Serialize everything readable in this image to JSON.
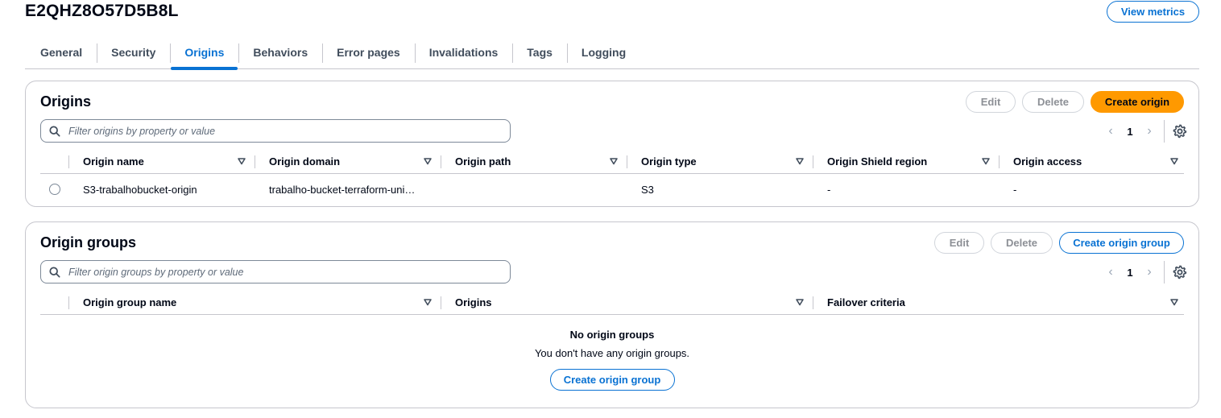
{
  "header": {
    "distribution_id": "E2QHZ8O57D5B8L",
    "view_metrics_label": "View metrics"
  },
  "tabs": [
    {
      "label": "General"
    },
    {
      "label": "Security"
    },
    {
      "label": "Origins",
      "active": true
    },
    {
      "label": "Behaviors"
    },
    {
      "label": "Error pages"
    },
    {
      "label": "Invalidations"
    },
    {
      "label": "Tags"
    },
    {
      "label": "Logging"
    }
  ],
  "origins": {
    "title": "Origins",
    "edit_label": "Edit",
    "delete_label": "Delete",
    "create_label": "Create origin",
    "filter_placeholder": "Filter origins by property or value",
    "page": "1",
    "columns": [
      "Origin name",
      "Origin domain",
      "Origin path",
      "Origin type",
      "Origin Shield region",
      "Origin access"
    ],
    "rows": [
      {
        "name": "S3-trabalhobucket-origin",
        "domain": "trabalho-bucket-terraform-uni…",
        "path": "",
        "type": "S3",
        "shield_region": "-",
        "access": "-"
      }
    ]
  },
  "origin_groups": {
    "title": "Origin groups",
    "edit_label": "Edit",
    "delete_label": "Delete",
    "create_label": "Create origin group",
    "filter_placeholder": "Filter origin groups by property or value",
    "page": "1",
    "columns": [
      "Origin group name",
      "Origins",
      "Failover criteria"
    ],
    "empty_title": "No origin groups",
    "empty_message": "You don't have any origin groups.",
    "empty_create_label": "Create origin group"
  },
  "colors": {
    "accent": "#0972d3",
    "primary_button": "#ff9900",
    "border": "#c6c6cd",
    "disabled_text": "#8d9096"
  },
  "icons": {
    "search": "search-icon",
    "sort": "sort-caret-icon",
    "settings": "gear-icon",
    "prev": "chevron-left-icon",
    "next": "chevron-right-icon"
  }
}
